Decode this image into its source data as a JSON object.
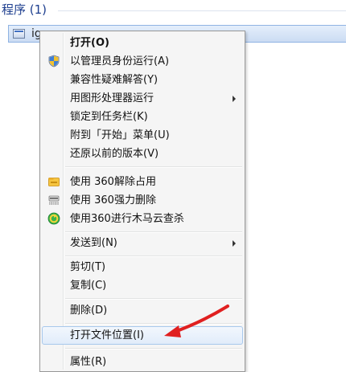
{
  "header": {
    "title": "程序 (1)"
  },
  "result": {
    "label": "ig…"
  },
  "menu": {
    "items": [
      {
        "label": "打开(O)",
        "bold": true
      },
      {
        "label": "以管理员身份运行(A)",
        "icon": "uac-shield-icon"
      },
      {
        "label": "兼容性疑难解答(Y)"
      },
      {
        "label": "用图形处理器运行",
        "submenu": true
      },
      {
        "label": "锁定到任务栏(K)"
      },
      {
        "label": "附到「开始」菜单(U)"
      },
      {
        "label": "还原以前的版本(V)"
      },
      {
        "label": "使用 360解除占用",
        "icon": "360-unlock-icon"
      },
      {
        "label": "使用 360强力删除",
        "icon": "360-shred-icon"
      },
      {
        "label": "使用360进行木马云查杀",
        "icon": "360-scan-icon"
      },
      {
        "label": "发送到(N)",
        "submenu": true
      },
      {
        "label": "剪切(T)"
      },
      {
        "label": "复制(C)"
      },
      {
        "label": "删除(D)"
      },
      {
        "label": "打开文件位置(I)",
        "highlighted": true
      },
      {
        "label": "属性(R)"
      }
    ]
  },
  "colors": {
    "header_text": "#1e3f8f",
    "annotation_arrow": "#e02020",
    "hover_border": "#a8c8ec"
  }
}
